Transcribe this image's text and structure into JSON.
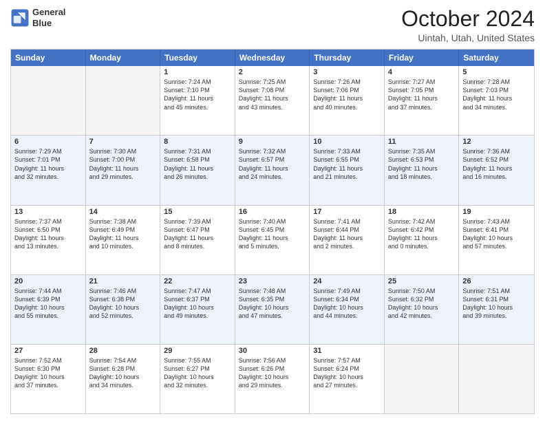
{
  "logo": {
    "line1": "General",
    "line2": "Blue"
  },
  "title": {
    "main": "October 2024",
    "sub": "Uintah, Utah, United States"
  },
  "days": [
    "Sunday",
    "Monday",
    "Tuesday",
    "Wednesday",
    "Thursday",
    "Friday",
    "Saturday"
  ],
  "weeks": [
    [
      {
        "num": "",
        "lines": []
      },
      {
        "num": "",
        "lines": []
      },
      {
        "num": "1",
        "lines": [
          "Sunrise: 7:24 AM",
          "Sunset: 7:10 PM",
          "Daylight: 11 hours",
          "and 45 minutes."
        ]
      },
      {
        "num": "2",
        "lines": [
          "Sunrise: 7:25 AM",
          "Sunset: 7:08 PM",
          "Daylight: 11 hours",
          "and 43 minutes."
        ]
      },
      {
        "num": "3",
        "lines": [
          "Sunrise: 7:26 AM",
          "Sunset: 7:06 PM",
          "Daylight: 11 hours",
          "and 40 minutes."
        ]
      },
      {
        "num": "4",
        "lines": [
          "Sunrise: 7:27 AM",
          "Sunset: 7:05 PM",
          "Daylight: 11 hours",
          "and 37 minutes."
        ]
      },
      {
        "num": "5",
        "lines": [
          "Sunrise: 7:28 AM",
          "Sunset: 7:03 PM",
          "Daylight: 11 hours",
          "and 34 minutes."
        ]
      }
    ],
    [
      {
        "num": "6",
        "lines": [
          "Sunrise: 7:29 AM",
          "Sunset: 7:01 PM",
          "Daylight: 11 hours",
          "and 32 minutes."
        ]
      },
      {
        "num": "7",
        "lines": [
          "Sunrise: 7:30 AM",
          "Sunset: 7:00 PM",
          "Daylight: 11 hours",
          "and 29 minutes."
        ]
      },
      {
        "num": "8",
        "lines": [
          "Sunrise: 7:31 AM",
          "Sunset: 6:58 PM",
          "Daylight: 11 hours",
          "and 26 minutes."
        ]
      },
      {
        "num": "9",
        "lines": [
          "Sunrise: 7:32 AM",
          "Sunset: 6:57 PM",
          "Daylight: 11 hours",
          "and 24 minutes."
        ]
      },
      {
        "num": "10",
        "lines": [
          "Sunrise: 7:33 AM",
          "Sunset: 6:55 PM",
          "Daylight: 11 hours",
          "and 21 minutes."
        ]
      },
      {
        "num": "11",
        "lines": [
          "Sunrise: 7:35 AM",
          "Sunset: 6:53 PM",
          "Daylight: 11 hours",
          "and 18 minutes."
        ]
      },
      {
        "num": "12",
        "lines": [
          "Sunrise: 7:36 AM",
          "Sunset: 6:52 PM",
          "Daylight: 11 hours",
          "and 16 minutes."
        ]
      }
    ],
    [
      {
        "num": "13",
        "lines": [
          "Sunrise: 7:37 AM",
          "Sunset: 6:50 PM",
          "Daylight: 11 hours",
          "and 13 minutes."
        ]
      },
      {
        "num": "14",
        "lines": [
          "Sunrise: 7:38 AM",
          "Sunset: 6:49 PM",
          "Daylight: 11 hours",
          "and 10 minutes."
        ]
      },
      {
        "num": "15",
        "lines": [
          "Sunrise: 7:39 AM",
          "Sunset: 6:47 PM",
          "Daylight: 11 hours",
          "and 8 minutes."
        ]
      },
      {
        "num": "16",
        "lines": [
          "Sunrise: 7:40 AM",
          "Sunset: 6:45 PM",
          "Daylight: 11 hours",
          "and 5 minutes."
        ]
      },
      {
        "num": "17",
        "lines": [
          "Sunrise: 7:41 AM",
          "Sunset: 6:44 PM",
          "Daylight: 11 hours",
          "and 2 minutes."
        ]
      },
      {
        "num": "18",
        "lines": [
          "Sunrise: 7:42 AM",
          "Sunset: 6:42 PM",
          "Daylight: 11 hours",
          "and 0 minutes."
        ]
      },
      {
        "num": "19",
        "lines": [
          "Sunrise: 7:43 AM",
          "Sunset: 6:41 PM",
          "Daylight: 10 hours",
          "and 57 minutes."
        ]
      }
    ],
    [
      {
        "num": "20",
        "lines": [
          "Sunrise: 7:44 AM",
          "Sunset: 6:39 PM",
          "Daylight: 10 hours",
          "and 55 minutes."
        ]
      },
      {
        "num": "21",
        "lines": [
          "Sunrise: 7:46 AM",
          "Sunset: 6:38 PM",
          "Daylight: 10 hours",
          "and 52 minutes."
        ]
      },
      {
        "num": "22",
        "lines": [
          "Sunrise: 7:47 AM",
          "Sunset: 6:37 PM",
          "Daylight: 10 hours",
          "and 49 minutes."
        ]
      },
      {
        "num": "23",
        "lines": [
          "Sunrise: 7:48 AM",
          "Sunset: 6:35 PM",
          "Daylight: 10 hours",
          "and 47 minutes."
        ]
      },
      {
        "num": "24",
        "lines": [
          "Sunrise: 7:49 AM",
          "Sunset: 6:34 PM",
          "Daylight: 10 hours",
          "and 44 minutes."
        ]
      },
      {
        "num": "25",
        "lines": [
          "Sunrise: 7:50 AM",
          "Sunset: 6:32 PM",
          "Daylight: 10 hours",
          "and 42 minutes."
        ]
      },
      {
        "num": "26",
        "lines": [
          "Sunrise: 7:51 AM",
          "Sunset: 6:31 PM",
          "Daylight: 10 hours",
          "and 39 minutes."
        ]
      }
    ],
    [
      {
        "num": "27",
        "lines": [
          "Sunrise: 7:52 AM",
          "Sunset: 6:30 PM",
          "Daylight: 10 hours",
          "and 37 minutes."
        ]
      },
      {
        "num": "28",
        "lines": [
          "Sunrise: 7:54 AM",
          "Sunset: 6:28 PM",
          "Daylight: 10 hours",
          "and 34 minutes."
        ]
      },
      {
        "num": "29",
        "lines": [
          "Sunrise: 7:55 AM",
          "Sunset: 6:27 PM",
          "Daylight: 10 hours",
          "and 32 minutes."
        ]
      },
      {
        "num": "30",
        "lines": [
          "Sunrise: 7:56 AM",
          "Sunset: 6:26 PM",
          "Daylight: 10 hours",
          "and 29 minutes."
        ]
      },
      {
        "num": "31",
        "lines": [
          "Sunrise: 7:57 AM",
          "Sunset: 6:24 PM",
          "Daylight: 10 hours",
          "and 27 minutes."
        ]
      },
      {
        "num": "",
        "lines": []
      },
      {
        "num": "",
        "lines": []
      }
    ]
  ]
}
